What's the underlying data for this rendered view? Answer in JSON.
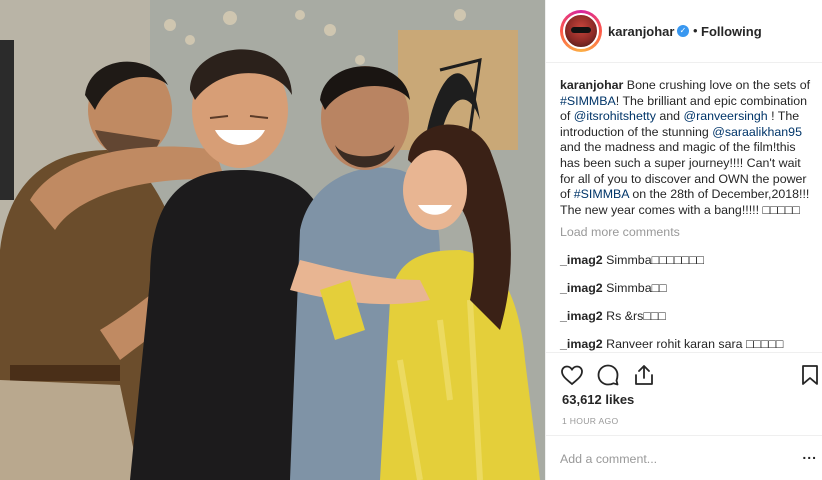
{
  "post": {
    "username": "karanjohar",
    "follow_status": "Following",
    "separator": "•",
    "verified_glyph": "✓",
    "caption": {
      "username": "karanjohar",
      "t1": " Bone crushing love on the sets of ",
      "hashtag1": "#SIMMBA",
      "t2": "! The brilliant and epic combination of ",
      "mention1": "@itsrohitshetty",
      "t3": " and ",
      "mention2": "@ranveersingh",
      "t4": " ! The introduction of the stunning ",
      "mention3": "@saraalikhan95",
      "t5": " and the madness and magic of the film!this has been such a super journey!!!! Can't wait for all of you to discover and OWN the power of ",
      "hashtag2": "#SIMMBA",
      "t6": " on the 28th of December,2018!!! The new year comes with a bang!!!!! □□□□□"
    },
    "load_more": "Load more comments",
    "comments": [
      {
        "user": "_imag2",
        "text": " Simmba□□□□□□□"
      },
      {
        "user": "_imag2",
        "text": " Simmba□□"
      },
      {
        "user": "_imag2",
        "text": " Rs &rs□□□"
      },
      {
        "user": "_imag2",
        "text": " Ranveer rohit karan sara □□□□□"
      }
    ],
    "likes": "63,612 likes",
    "time": "1 HOUR AGO",
    "add_comment_placeholder": "Add a comment...",
    "more_options": "..."
  },
  "icons": {
    "heart": "heart-icon",
    "comment": "comment-icon",
    "share": "share-icon",
    "bookmark": "bookmark-icon",
    "verified": "verified-badge-icon"
  },
  "colors": {
    "verified": "#3897f0",
    "link": "#003569",
    "muted": "#999999",
    "text": "#262626"
  }
}
